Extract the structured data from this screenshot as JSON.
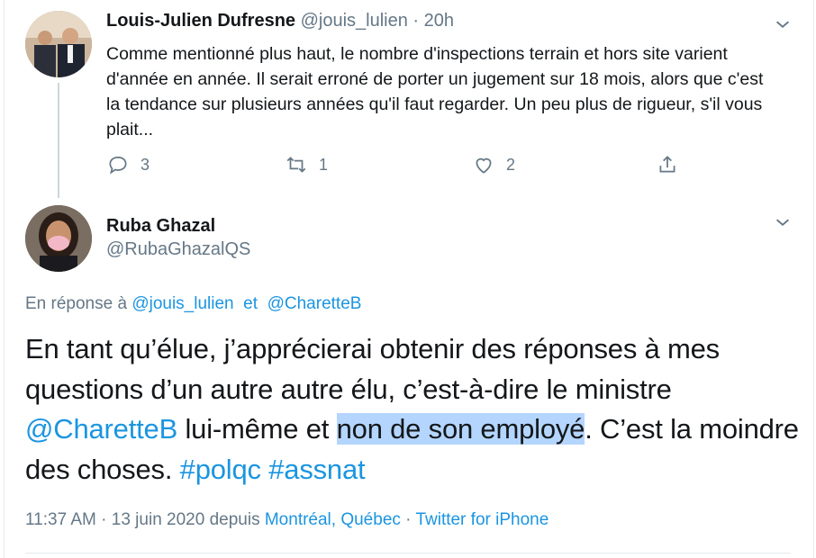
{
  "tweet1": {
    "author_name": "Louis-Julien Dufresne",
    "handle": "@jouis_lulien",
    "separator": "·",
    "time": "20h",
    "text": "Comme mentionné plus haut, le nombre d'inspections terrain et hors site varient d'année en année. Il serait erroné de porter un jugement sur 18 mois, alors que c'est la tendance sur plusieurs années qu'il faut regarder. Un peu plus de rigueur, s'il vous plait...",
    "reply_count": "3",
    "retweet_count": "1",
    "like_count": "2"
  },
  "tweet2": {
    "author_name": "Ruba Ghazal",
    "handle": "@RubaGhazalQS",
    "reply_prefix": "En réponse à",
    "reply_to_1": "@jouis_lulien",
    "reply_and": "et",
    "reply_to_2": "@CharetteB",
    "text_part1": "En tant qu’élue, j’apprécierai obtenir des réponses à mes questions d’un autre autre élu, c’est-à-dire le ministre ",
    "mention": "@CharetteB",
    "text_part2": " lui-même et ",
    "highlighted": "non de son employé",
    "text_part3": ". C’est la moindre des choses. ",
    "hashtag1": "#polqc",
    "hashtag2": "#assnat",
    "time": "11:37 AM",
    "meta_sep1": "·",
    "date": "13 juin 2020 depuis",
    "location": "Montréal, Québec",
    "meta_sep2": "·",
    "client": "Twitter for iPhone"
  },
  "icons": [
    "chevron-down-icon",
    "reply-icon",
    "retweet-icon",
    "like-icon",
    "share-icon"
  ],
  "colors": {
    "link": "#1b95e0",
    "muted": "#657786",
    "text": "#14171a",
    "highlight": "#b4d5fe",
    "thread_line": "#ccd6dd"
  }
}
